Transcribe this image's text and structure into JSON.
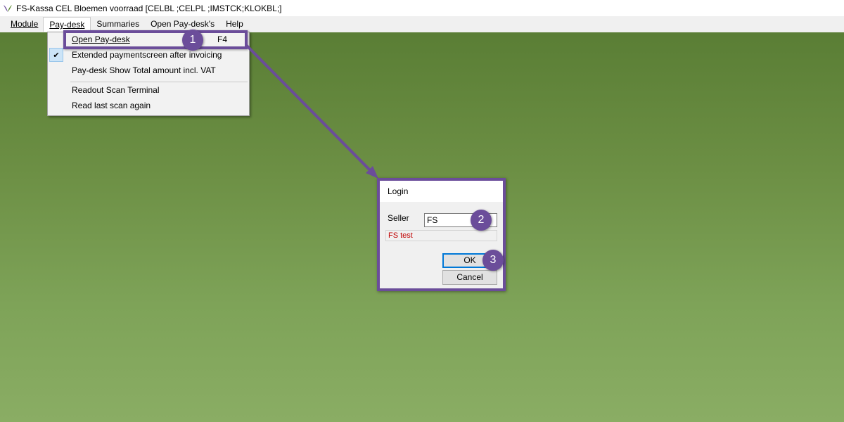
{
  "window": {
    "title": "FS-Kassa CEL Bloemen voorraad [CELBL ;CELPL ;IMSTCK;KLOKBL;]",
    "logo_icon": "leaf-logo-icon"
  },
  "menubar": {
    "items": [
      {
        "label": "Module"
      },
      {
        "label": "Pay-desk"
      },
      {
        "label": "Summaries"
      },
      {
        "label": "Open Pay-desk's"
      },
      {
        "label": "Help"
      }
    ]
  },
  "dropdown": {
    "items": [
      {
        "label": "Open Pay-desk",
        "shortcut": "F4"
      },
      {
        "label": "Extended paymentscreen after invoicing",
        "checked": true
      },
      {
        "label": "Pay-desk Show Total amount incl. VAT"
      },
      {
        "label": "Readout Scan Terminal"
      },
      {
        "label": "Read last scan again"
      }
    ]
  },
  "login": {
    "title": "Login",
    "seller_label": "Seller",
    "seller_value": "FS",
    "status_text": "FS test",
    "ok_label": "OK",
    "cancel_label": "Cancel"
  },
  "annotations": {
    "step1": "1",
    "step2": "2",
    "step3": "3",
    "color": "#6b4d9a"
  },
  "colors": {
    "desktop_top": "#5a7e35",
    "desktop_bottom": "#8aad64",
    "status_text": "#c00000",
    "ok_focus_border": "#0078d7"
  }
}
